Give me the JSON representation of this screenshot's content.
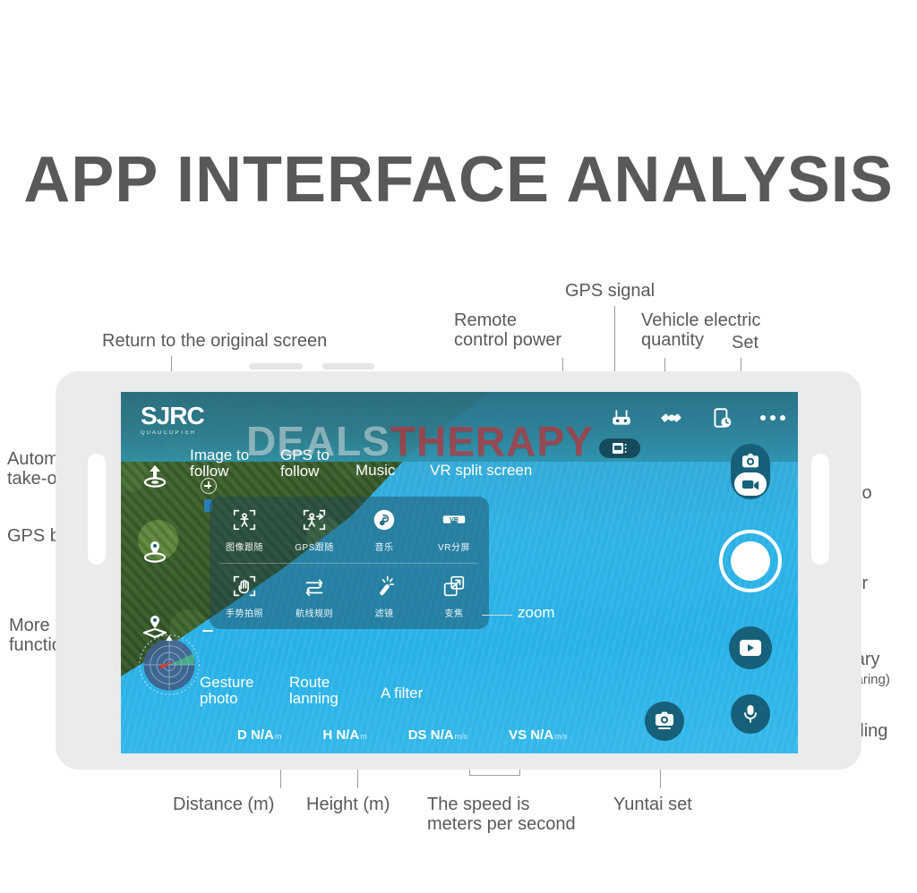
{
  "page": {
    "title": "APP INTERFACE ANALYSIS"
  },
  "annotations": {
    "return_original": "Return to the original screen",
    "remote_power": "Remote\ncontrol power",
    "gps_signal": "GPS signal",
    "vehicle_battery": "Vehicle electric\nquantity",
    "set": "Set",
    "automatic_takeoff": "Automatic\ntake-off",
    "gps_back": "GPS back",
    "more_functions": "More\nfunctions",
    "photo_video_toggle": "Photo/video\ntoggle",
    "the_shutter": "The shutter",
    "media_library": "Media library",
    "media_library_sub": "(One-click sharing)",
    "the_recording": "The recording",
    "distance": "Distance (m)",
    "height": "Height (m)",
    "speed": "The speed is\nmeters per second",
    "yuntai_set": "Yuntai set"
  },
  "overlay_labels": {
    "image_follow": "Image to\nfollow",
    "gps_follow": "GPS to\nfollow",
    "music": "Music",
    "vr_split": "VR split screen",
    "gesture_photo": "Gesture\nphoto",
    "route_planning": "Route\nlanning",
    "a_filter": "A filter",
    "zoom": "zoom"
  },
  "app": {
    "logo": {
      "main": "SJRC",
      "sub": "QUADCOPTER"
    },
    "watermark": {
      "part1": "DEALS",
      "part2": "THERAPY"
    },
    "status_icons": [
      {
        "name": "remote-controller-icon",
        "label": "Remote control power"
      },
      {
        "name": "satellite-icon",
        "label": "GPS signal"
      },
      {
        "name": "battery-clock-icon",
        "label": "Vehicle electric quantity"
      },
      {
        "name": "more-menu-icon",
        "label": "Set"
      }
    ],
    "left_controls": [
      {
        "name": "auto-takeoff-icon",
        "label": "Automatic take-off"
      },
      {
        "name": "gps-return-icon",
        "label": "GPS back"
      },
      {
        "name": "more-functions-icon",
        "label": "More functions"
      }
    ],
    "menu_items": [
      {
        "icon": "image-follow-icon",
        "cn": "图像跟随",
        "en": "Image to follow"
      },
      {
        "icon": "gps-follow-icon",
        "cn": "GPS跟随",
        "en": "GPS to follow"
      },
      {
        "icon": "music-icon",
        "cn": "音乐",
        "en": "Music"
      },
      {
        "icon": "vr-icon",
        "cn": "VR分屏",
        "en": "VR split screen"
      },
      {
        "icon": "gesture-photo-icon",
        "cn": "手势拍照",
        "en": "Gesture photo"
      },
      {
        "icon": "route-plan-icon",
        "cn": "航线规则",
        "en": "Route planning"
      },
      {
        "icon": "filter-icon",
        "cn": "滤镜",
        "en": "A filter"
      },
      {
        "icon": "zoom-icon",
        "cn": "变焦",
        "en": "zoom"
      }
    ],
    "telemetry": [
      {
        "key": "D",
        "value": "N/A",
        "unit": "m"
      },
      {
        "key": "H",
        "value": "N/A",
        "unit": "m"
      },
      {
        "key": "DS",
        "value": "N/A",
        "unit": "m/s"
      },
      {
        "key": "VS",
        "value": "N/A",
        "unit": "m/s"
      }
    ],
    "right_controls": [
      {
        "name": "photo-video-toggle",
        "label": "Photo/video toggle"
      },
      {
        "name": "shutter-button",
        "label": "The shutter"
      },
      {
        "name": "media-library-button",
        "label": "Media library"
      },
      {
        "name": "microphone-button",
        "label": "The recording"
      },
      {
        "name": "gimbal-set-button",
        "label": "Yuntai set"
      }
    ]
  },
  "colors": {
    "title": "#58595b",
    "annotation": "#5a5a5a",
    "tablet_body": "#e9ebec",
    "water": "#29b2e8",
    "app_accent": "#17607a",
    "leader": "#9b9b9b"
  }
}
